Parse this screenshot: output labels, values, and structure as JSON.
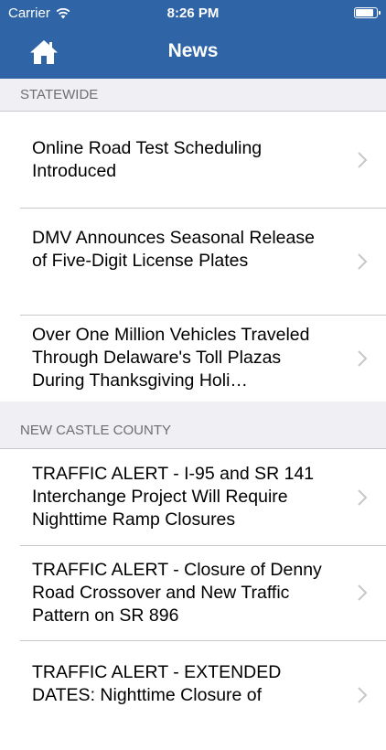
{
  "status_bar": {
    "carrier": "Carrier",
    "time": "8:26 PM",
    "battery_level": 0.95
  },
  "navbar": {
    "title": "News",
    "home_icon": "house-icon"
  },
  "sections": [
    {
      "header": "STATEWIDE",
      "items": [
        {
          "title": "Online Road Test Scheduling Introduced"
        },
        {
          "title": "DMV Announces Seasonal Release of Five-Digit License Plates"
        },
        {
          "title": "Over One Million Vehicles Traveled Through Delaware's Toll Plazas During Thanksgiving Holi…"
        }
      ]
    },
    {
      "header": "NEW CASTLE COUNTY",
      "items": [
        {
          "title": "TRAFFIC ALERT - I-95 and SR 141 Interchange Project Will Require Nighttime Ramp Closures"
        },
        {
          "title": "TRAFFIC ALERT - Closure of Denny Road Crossover and New Traffic Pattern on SR 896"
        },
        {
          "title": "TRAFFIC ALERT - EXTENDED DATES: Nighttime Closure of"
        }
      ]
    }
  ]
}
